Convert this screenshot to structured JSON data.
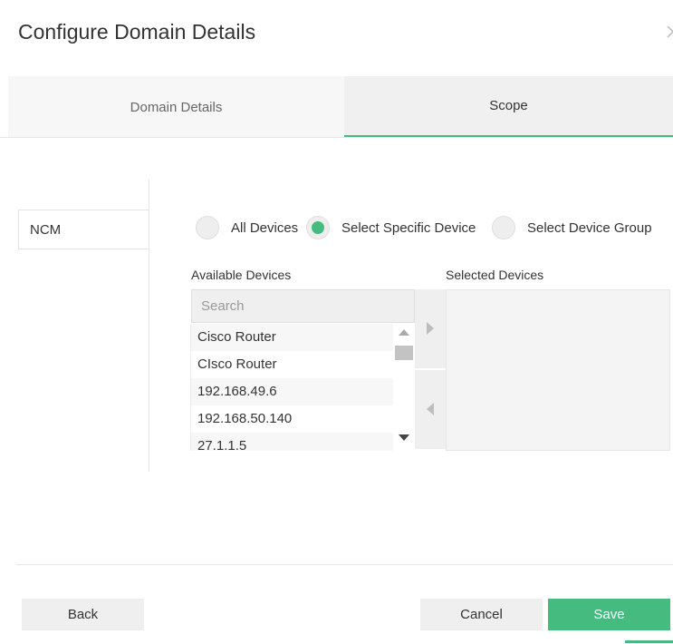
{
  "dialog": {
    "title": "Configure Domain Details"
  },
  "tabs": [
    {
      "label": "Domain Details",
      "active": false
    },
    {
      "label": "Scope",
      "active": true
    }
  ],
  "modules": [
    {
      "label": "NCM"
    }
  ],
  "scope_options": [
    {
      "label": "All Devices",
      "checked": false
    },
    {
      "label": "Select Specific Device",
      "checked": true
    },
    {
      "label": "Select Device Group",
      "checked": false
    }
  ],
  "available": {
    "label": "Available Devices",
    "search_placeholder": "Search",
    "devices": [
      "Cisco Router",
      "CIsco Router",
      "192.168.49.6",
      "192.168.50.140",
      "27.1.1.5"
    ]
  },
  "selected": {
    "label": "Selected Devices",
    "devices": []
  },
  "footer": {
    "back_label": "Back",
    "cancel_label": "Cancel",
    "save_label": "Save"
  },
  "colors": {
    "accent": "#45bb7f",
    "panel_bg": "#efefef"
  }
}
